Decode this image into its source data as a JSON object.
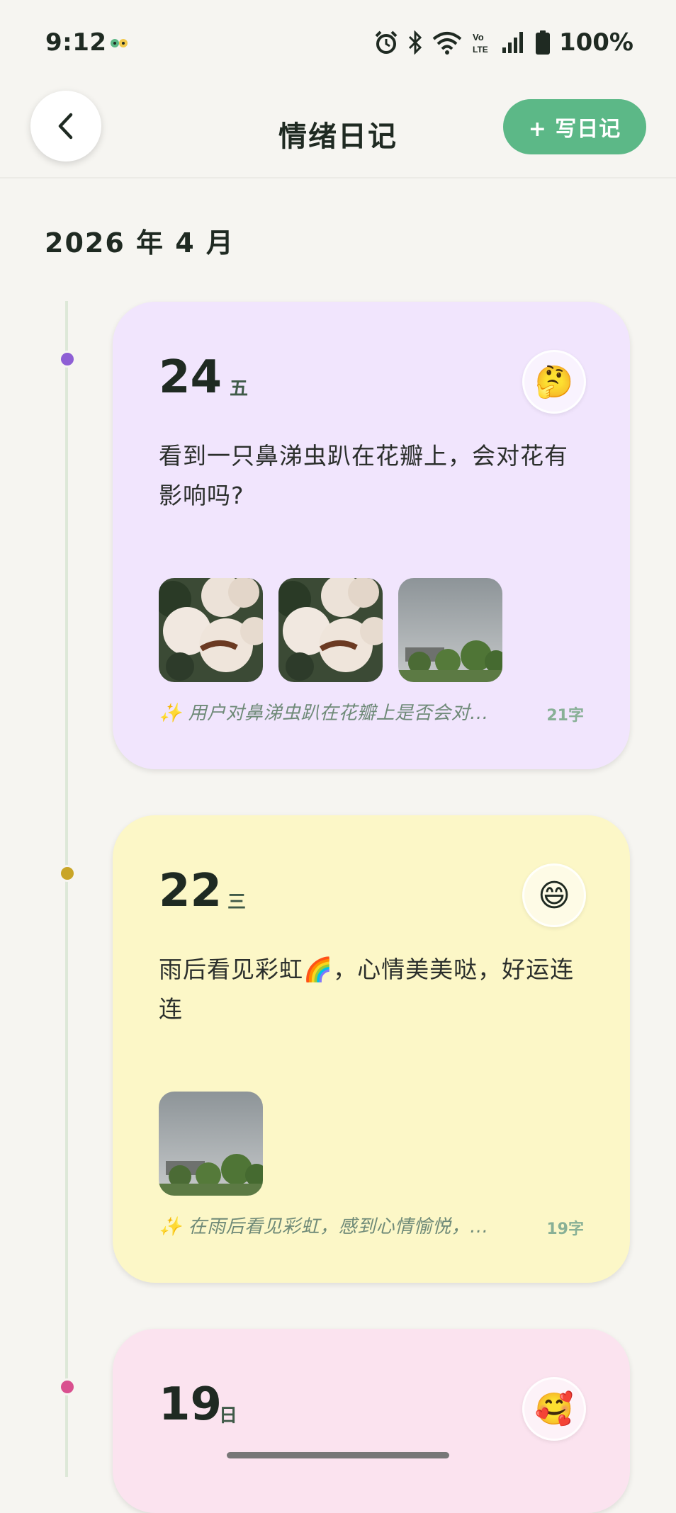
{
  "status_bar": {
    "time": "9:12",
    "battery": "100%",
    "icons": [
      "alarm-icon",
      "bluetooth-icon",
      "wifi-icon",
      "volte-icon",
      "signal-icon",
      "battery-icon"
    ]
  },
  "header": {
    "back_icon": "chevron-left-icon",
    "title": "情绪日记",
    "write_button": "+ 写日记"
  },
  "month_label": "2026 年 4 月",
  "colors": {
    "accent": "#5cb887",
    "card_purple": "#f1e5fd",
    "card_yellow": "#fcf7c7",
    "card_pink": "#fbe3ef",
    "dot_purple": "#8e5fd5",
    "dot_yellow": "#c9a527",
    "dot_pink": "#d9508f"
  },
  "entries": [
    {
      "day": "24",
      "weekday": "五",
      "mood_icon": "thinking-face-icon",
      "mood_emoji": "🤔",
      "text": "看到一只鼻涕虫趴在花瓣上，会对花有影响吗?",
      "photos": [
        "white-roses-photo",
        "white-roses-photo",
        "cloudy-sky-trees-photo"
      ],
      "summary": "✨ 用户对鼻涕虫趴在花瓣上是否会对...",
      "word_count": "21字"
    },
    {
      "day": "22",
      "weekday": "三",
      "mood_icon": "grinning-face-icon",
      "mood_emoji": "😄",
      "text": "雨后看见彩虹🌈，心情美美哒，好运连连",
      "photos": [
        "cloudy-sky-trees-photo"
      ],
      "summary": "✨ 在雨后看见彩虹，感到心情愉悦，...",
      "word_count": "19字"
    },
    {
      "day": "19",
      "weekday": "日",
      "mood_icon": "smiling-face-with-hearts-icon",
      "mood_emoji": "🥰"
    }
  ]
}
